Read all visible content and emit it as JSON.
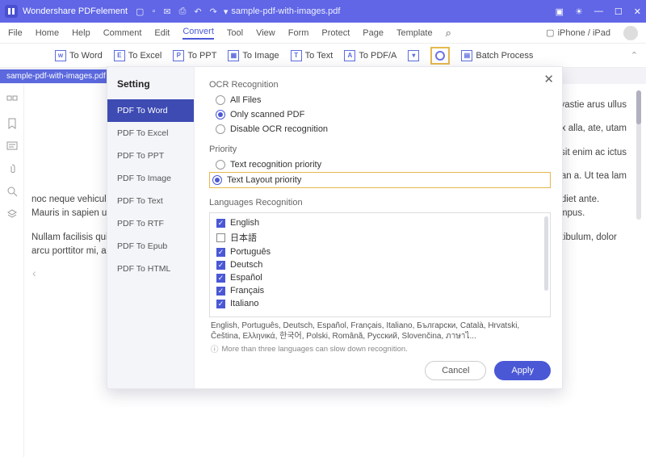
{
  "titlebar": {
    "app_name": "Wondershare PDFelement",
    "current_file": "sample-pdf-with-images.pdf"
  },
  "menu": {
    "items": [
      "File",
      "Home",
      "Help",
      "Comment",
      "Edit",
      "Convert",
      "Tool",
      "View",
      "Form",
      "Protect",
      "Page",
      "Template"
    ],
    "active": "Convert",
    "device_label": "iPhone / iPad"
  },
  "ribbon": {
    "buttons": [
      {
        "icon": "W",
        "label": "To Word"
      },
      {
        "icon": "E",
        "label": "To Excel"
      },
      {
        "icon": "P",
        "label": "To PPT"
      },
      {
        "icon": "I",
        "label": "To Image"
      },
      {
        "icon": "T",
        "label": "To Text"
      },
      {
        "icon": "A",
        "label": "To PDF/A"
      }
    ],
    "batch_label": "Batch Process"
  },
  "tab": {
    "name": "sample-pdf-with-images.pdf"
  },
  "dialog": {
    "title": "Setting",
    "side_items": [
      "PDF To Word",
      "PDF To Excel",
      "PDF To PPT",
      "PDF To Image",
      "PDF To Text",
      "PDF To RTF",
      "PDF To Epub",
      "PDF To HTML"
    ],
    "side_selected": "PDF To Word",
    "ocr": {
      "title": "OCR Recognition",
      "options": [
        "All Files",
        "Only scanned PDF",
        "Disable OCR recognition"
      ],
      "selected": "Only scanned PDF"
    },
    "priority": {
      "title": "Priority",
      "options": [
        "Text recognition priority",
        "Text Layout priority"
      ],
      "selected": "Text Layout priority"
    },
    "languages": {
      "title": "Languages Recognition",
      "items": [
        {
          "label": "English",
          "checked": true
        },
        {
          "label": "日本語",
          "checked": false
        },
        {
          "label": "Português",
          "checked": true
        },
        {
          "label": "Deutsch",
          "checked": true
        },
        {
          "label": "Español",
          "checked": true
        },
        {
          "label": "Français",
          "checked": true
        },
        {
          "label": "Italiano",
          "checked": true
        }
      ],
      "summary": "English, Português, Deutsch, Español, Français, Italiano, Български, Català, Hrvatski, Čeština, Ελληνικά, 한국어, Polski, Română, Русский, Slovenčina, ภาษาไ...",
      "hint": "More than three languages can slow down recognition."
    },
    "cancel": "Cancel",
    "apply": "Apply"
  },
  "doc_text": {
    "p1": "ucus amet ivastie arus ullus",
    "p2": "a ex alla, ate, utam",
    "p3": "quis sed sit enim ac ictus",
    "p4": "ean a. Ut tea lam",
    "p5": "noc neque vehicula, ac molestie ante ornare. Sed sit amet nisi mollis, egestas justo sit, rhoncus nunc. In aliquam ante, non imperdiet ante. Mauris in sapien ut quam hendrerit mollis. Proin feugiat dignissim nisi, sed tincidunt ante aliquam et. Integer finibus et augue a tempus.",
    "p6": "Nullam facilisis quis nisl sit amet iaculis. Integer hendrerit metus in faucibus aliquet. Donec fermentum, lacus lobortis pulvinar vestibulum, dolor arcu porttitor mi, ac pulvinar lacus magna"
  }
}
